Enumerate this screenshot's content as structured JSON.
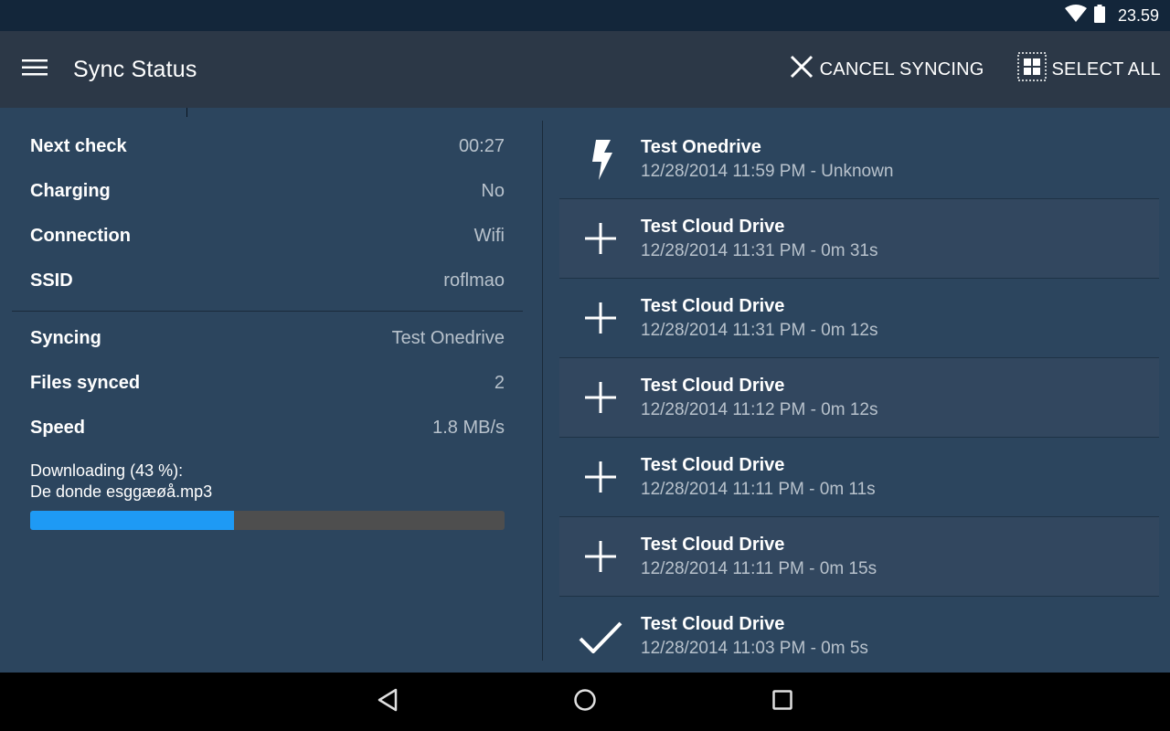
{
  "status_bar": {
    "wifi_icon": "wifi-icon",
    "battery_icon": "battery-icon",
    "time": "23.59"
  },
  "app_bar": {
    "menu_icon": "hamburger-menu-icon",
    "title": "Sync Status",
    "actions": [
      {
        "icon": "close-icon",
        "label": "CANCEL SYNCING"
      },
      {
        "icon": "select-all-icon",
        "label": "SELECT ALL"
      }
    ]
  },
  "status_info": {
    "device": [
      {
        "key": "Next check",
        "value": "00:27"
      },
      {
        "key": "Charging",
        "value": "No"
      },
      {
        "key": "Connection",
        "value": "Wifi"
      },
      {
        "key": "SSID",
        "value": "roflmao"
      }
    ],
    "sync": [
      {
        "key": "Syncing",
        "value": "Test Onedrive"
      },
      {
        "key": "Files synced",
        "value": "2"
      },
      {
        "key": "Speed",
        "value": "1.8 MB/s"
      }
    ],
    "download": {
      "label": "Downloading (43 %):",
      "filename": "De donde esggæøå.mp3",
      "progress_percent": 43,
      "fill_color": "#1e9af5",
      "track_color": "#4e4e4e"
    }
  },
  "sync_history": [
    {
      "icon": "lightning-icon",
      "title": "Test Onedrive",
      "subtitle": "12/28/2014 11:59 PM - Unknown"
    },
    {
      "icon": "plus-icon",
      "title": "Test Cloud Drive",
      "subtitle": "12/28/2014 11:31 PM - 0m 31s"
    },
    {
      "icon": "plus-icon",
      "title": "Test Cloud Drive",
      "subtitle": "12/28/2014 11:31 PM - 0m 12s"
    },
    {
      "icon": "plus-icon",
      "title": "Test Cloud Drive",
      "subtitle": "12/28/2014 11:12 PM - 0m 12s"
    },
    {
      "icon": "plus-icon",
      "title": "Test Cloud Drive",
      "subtitle": "12/28/2014 11:11 PM - 0m 11s"
    },
    {
      "icon": "plus-icon",
      "title": "Test Cloud Drive",
      "subtitle": "12/28/2014 11:11 PM - 0m 15s"
    },
    {
      "icon": "checkmark-icon",
      "title": "Test Cloud Drive",
      "subtitle": "12/28/2014 11:03 PM - 0m 5s"
    }
  ],
  "nav_bar": {
    "back": "back-icon",
    "home": "home-icon",
    "recents": "recents-icon"
  },
  "colors": {
    "background": "#2c455e",
    "app_bar": "#2c3847",
    "status_bar": "#13263a",
    "alt_row": "#32475f",
    "accent": "#1e9af5"
  }
}
